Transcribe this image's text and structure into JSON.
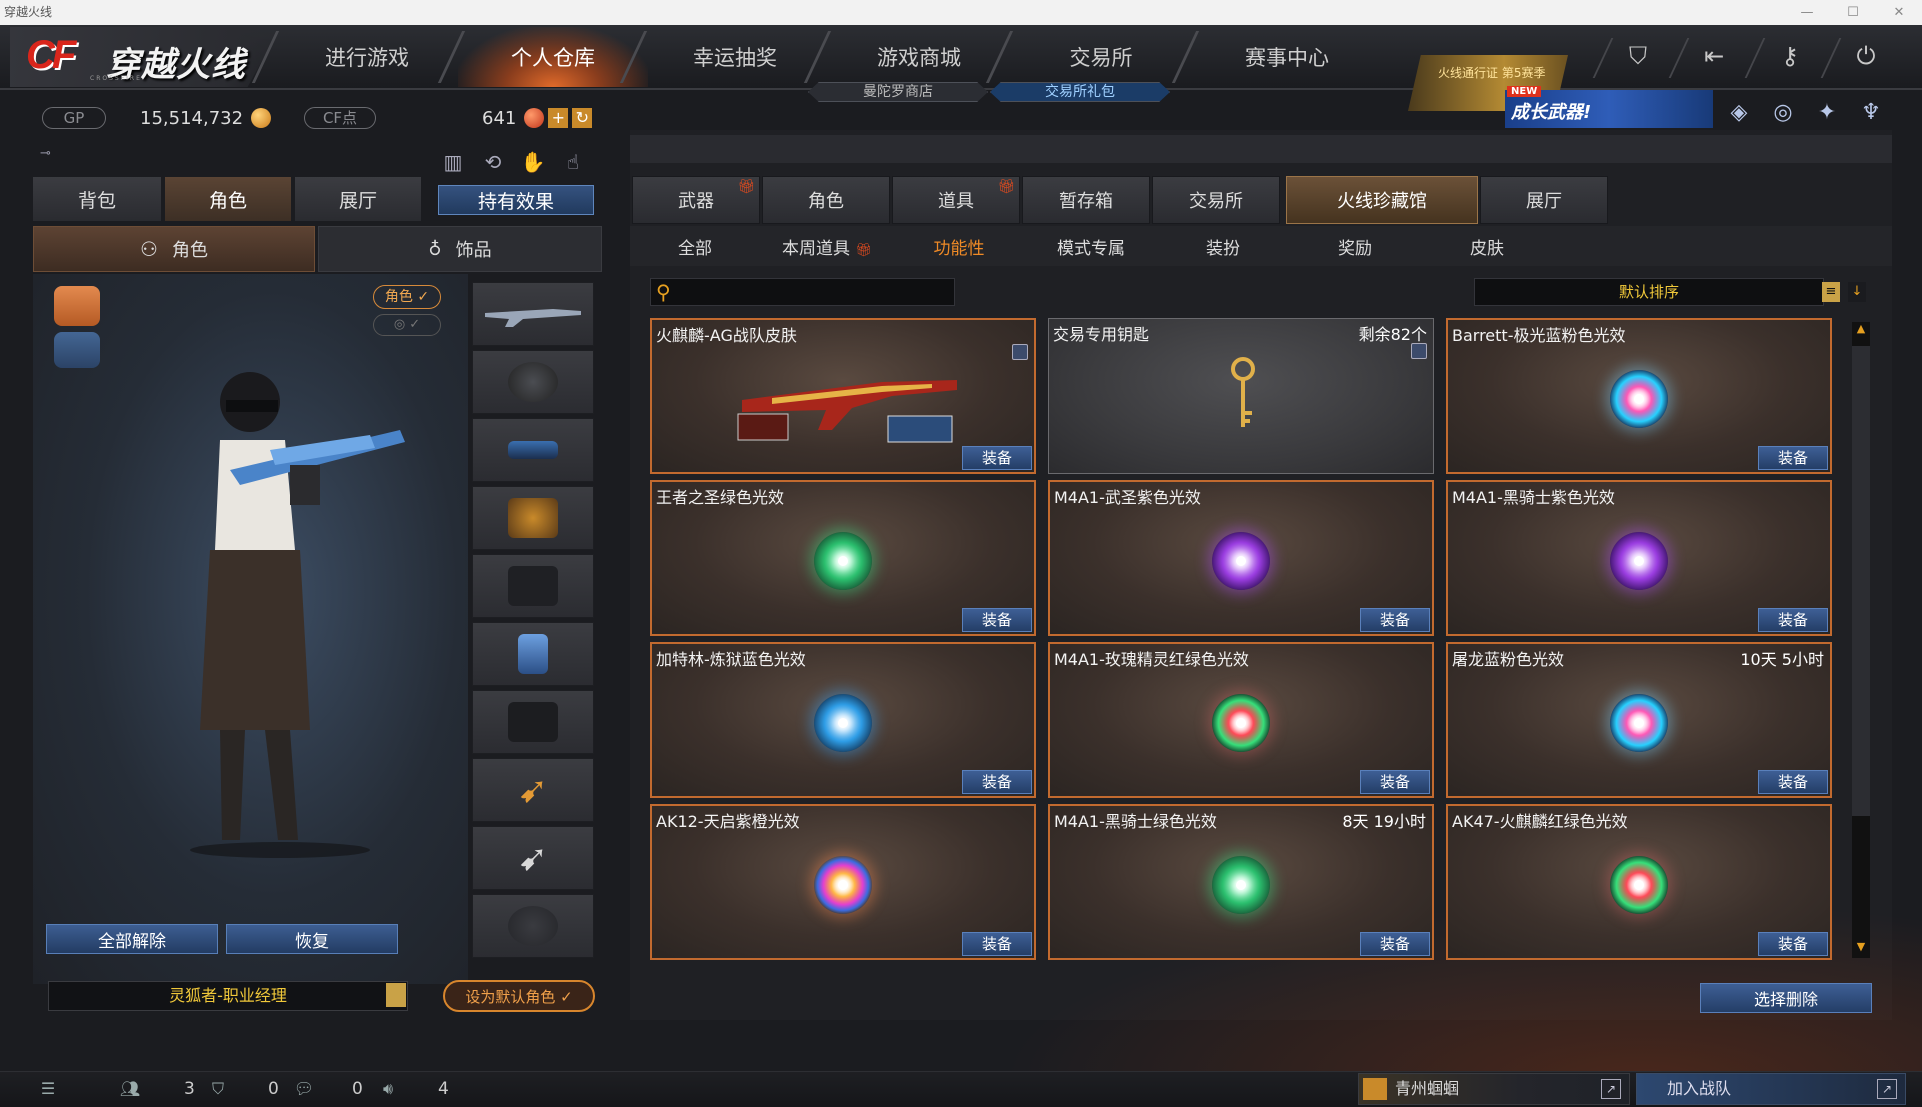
{
  "window": {
    "title": "穿越火线"
  },
  "header": {
    "logo_cf": "CF",
    "logo_text": "穿越火线",
    "logo_sub": "CROSSFIRE",
    "nav": [
      "进行游戏",
      "个人仓库",
      "幸运抽奖",
      "游戏商城",
      "交易所",
      "赛事中心"
    ],
    "active_nav": "个人仓库",
    "passport": "火线通行证 第5赛季",
    "subnav": [
      "曼陀罗商店",
      "交易所礼包"
    ],
    "icons": [
      "shield-icon",
      "exit-icon",
      "key-icon",
      "power-icon"
    ]
  },
  "wallet": {
    "gp_label": "GP",
    "gp_value": "15,514,732",
    "cf_label": "CF点",
    "cf_value": "641",
    "colors": {
      "gold": "#e6a020",
      "accent_orange": "#ef8a26",
      "button_blue": "#3e5f95"
    }
  },
  "promo": {
    "badge": "NEW",
    "text": "成长武器!"
  },
  "left": {
    "tabs": [
      "背包",
      "角色",
      "展厅"
    ],
    "active_tab": "角色",
    "effect_button": "持有效果",
    "subtabs": [
      "角色",
      "饰品"
    ],
    "role_toggle": "角色 ✓",
    "unequip_all": "全部解除",
    "restore": "恢复",
    "role_name": "灵狐者-职业经理",
    "set_default": "设为默认角色 ✓"
  },
  "right": {
    "tabs": [
      "武器",
      "角色",
      "道具",
      "暂存箱",
      "交易所",
      "火线珍藏馆",
      "展厅"
    ],
    "active_tab": "火线珍藏馆",
    "subtabs": [
      "全部",
      "本周道具",
      "功能性",
      "模式专属",
      "装扮",
      "奖励",
      "皮肤"
    ],
    "active_subtab": "功能性",
    "search_placeholder": "",
    "sort_label": "默认排序",
    "delete_button": "选择删除",
    "items": [
      {
        "name": "火麒麟-AG战队皮肤",
        "extra": "",
        "equip": "装备",
        "art": "gun",
        "locked": true
      },
      {
        "name": "交易专用钥匙",
        "extra": "剩余82个",
        "equip": "",
        "art": "key",
        "locked": true
      },
      {
        "name": "Barrett-极光蓝粉色光效",
        "extra": "",
        "equip": "装备",
        "art": "pinkblue"
      },
      {
        "name": "王者之圣绿色光效",
        "extra": "",
        "equip": "装备",
        "art": "green"
      },
      {
        "name": "M4A1-武圣紫色光效",
        "extra": "",
        "equip": "装备",
        "art": "purple"
      },
      {
        "name": "M4A1-黑骑士紫色光效",
        "extra": "",
        "equip": "装备",
        "art": "purple"
      },
      {
        "name": "加特林-炼狱蓝色光效",
        "extra": "",
        "equip": "装备",
        "art": "blue"
      },
      {
        "name": "M4A1-玫瑰精灵红绿色光效",
        "extra": "",
        "equip": "装备",
        "art": "redgreen"
      },
      {
        "name": "屠龙蓝粉色光效",
        "extra": "10天 5小时",
        "equip": "装备",
        "art": "pinkblue"
      },
      {
        "name": "AK12-天启紫橙光效",
        "extra": "",
        "equip": "装备",
        "art": "rainbow"
      },
      {
        "name": "M4A1-黑骑士绿色光效",
        "extra": "8天 19小时",
        "equip": "装备",
        "art": "green"
      },
      {
        "name": "AK47-火麒麟红绿色光效",
        "extra": "",
        "equip": "装备",
        "art": "redgreen"
      }
    ]
  },
  "status": {
    "friends": "3",
    "guild": "0",
    "messages": "0",
    "volume": "4",
    "clan_name": "青州蝈蝈",
    "join_team": "加入战队"
  }
}
